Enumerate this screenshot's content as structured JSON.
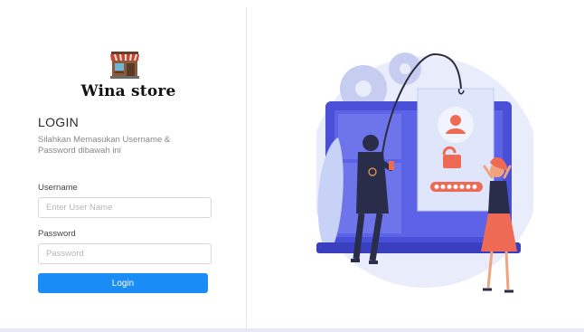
{
  "brand": {
    "name": "Wina store",
    "logo_icon": "storefront-icon"
  },
  "login": {
    "title": "LOGIN",
    "subtitle": "Silahkan Memasukan Username & Password dibawah ini",
    "username_label": "Username",
    "username_placeholder": "Enter User Name",
    "username_value": "",
    "password_label": "Password",
    "password_placeholder": "Password",
    "password_value": "",
    "submit_label": "Login"
  },
  "illustration": {
    "icon": "phishing-security-illustration",
    "pin_dots": 7
  },
  "colors": {
    "accent": "#1a8cf5",
    "illustration_bg": "#e9ecfb",
    "laptop": "#4a4fd8",
    "woman_dress": "#ee6a55"
  }
}
